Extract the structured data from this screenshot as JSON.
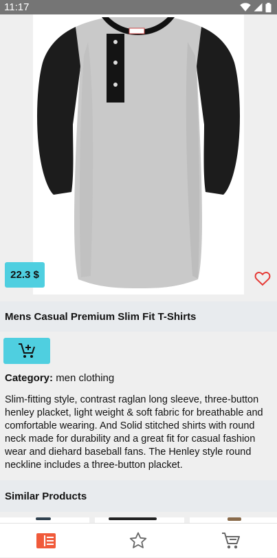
{
  "status_bar": {
    "time": "11:17"
  },
  "product": {
    "price": "22.3 $",
    "title": "Mens Casual Premium Slim Fit T-Shirts",
    "category_label": "Category:",
    "category_value": "men clothing",
    "description": "Slim-fitting style, contrast raglan long sleeve, three-button henley placket, light weight & soft fabric for breathable and comfortable wearing. And Solid stitched shirts with round neck made for durability and a great fit for casual fashion wear and diehard baseball fans. The Henley style round neckline includes a three-button placket."
  },
  "similar": {
    "title": "Similar Products"
  },
  "icons": {
    "favorite": "heart-outline-icon",
    "add_to_cart": "cart-plus-icon",
    "nav_catalog": "catalog-icon",
    "nav_favorites": "star-outline-icon",
    "nav_cart": "cart-icon"
  },
  "colors": {
    "accent": "#4fcfe0",
    "heart": "#e53935",
    "nav_active": "#f05a3a",
    "nav_inactive": "#666666"
  }
}
